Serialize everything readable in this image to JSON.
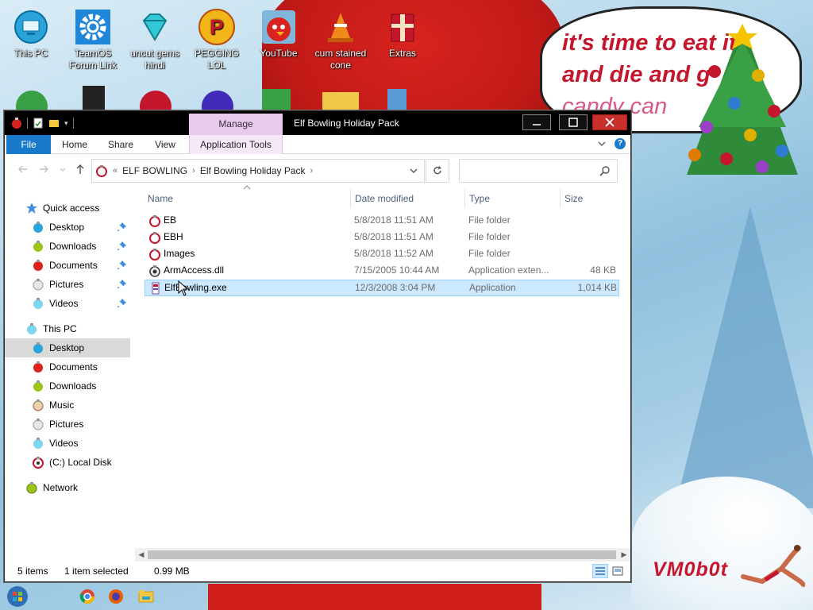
{
  "wallpaper": {
    "bubble_line1": "it's time to eat it",
    "bubble_line2": "and die and g",
    "bubble_line3": "candy can",
    "signature": "VM0b0t"
  },
  "desktop_icons": [
    {
      "label": "This PC",
      "icon": "this-pc-icon"
    },
    {
      "label": "TeamOS Forum Link",
      "icon": "gear-icon"
    },
    {
      "label": "uncut gems hindi",
      "icon": "diamond-icon"
    },
    {
      "label": "PEGGING LOL",
      "icon": "peggle-icon"
    },
    {
      "label": "YouTube",
      "icon": "angry-bird-icon"
    },
    {
      "label": "cum stained cone",
      "icon": "traffic-cone-icon"
    },
    {
      "label": "Extras",
      "icon": "gift-box-icon"
    }
  ],
  "window": {
    "title": "Elf Bowling Holiday Pack",
    "manage_tab": "Manage",
    "ribbon_tabs": [
      "File",
      "Home",
      "Share",
      "View",
      "Application Tools"
    ],
    "address": {
      "overflow": "«",
      "crumbs": [
        "ELF BOWLING",
        "Elf Bowling Holiday Pack"
      ]
    },
    "search_placeholder": "",
    "columns": {
      "name": "Name",
      "date": "Date modified",
      "type": "Type",
      "size": "Size"
    },
    "files": [
      {
        "name": "EB",
        "date": "5/8/2018 11:51 AM",
        "type": "File folder",
        "size": "",
        "icon": "folder-ornament-icon"
      },
      {
        "name": "EBH",
        "date": "5/8/2018 11:51 AM",
        "type": "File folder",
        "size": "",
        "icon": "folder-ornament-icon"
      },
      {
        "name": "Images",
        "date": "5/8/2018 11:52 AM",
        "type": "File folder",
        "size": "",
        "icon": "folder-ornament-icon"
      },
      {
        "name": "ArmAccess.dll",
        "date": "7/15/2005 10:44 AM",
        "type": "Application exten...",
        "size": "48 KB",
        "icon": "dll-icon"
      },
      {
        "name": "ElfBowling.exe",
        "date": "12/3/2008 3:04 PM",
        "type": "Application",
        "size": "1,014 KB",
        "icon": "exe-icon",
        "selected": true
      }
    ],
    "nav": {
      "quick_access": "Quick access",
      "quick_items": [
        "Desktop",
        "Downloads",
        "Documents",
        "Pictures",
        "Videos"
      ],
      "this_pc": "This PC",
      "pc_items": [
        "Desktop",
        "Documents",
        "Downloads",
        "Music",
        "Pictures",
        "Videos",
        "(C:) Local Disk"
      ],
      "network": "Network"
    },
    "status": {
      "items": "5 items",
      "selected": "1 item selected",
      "size": "0.99 MB"
    }
  },
  "colors": {
    "accent": "#1979ca",
    "selection": "#cce8ff",
    "manage_tab": "#e9c9ee",
    "close_button": "#c9302c",
    "wallpaper_red": "#c4162c"
  }
}
